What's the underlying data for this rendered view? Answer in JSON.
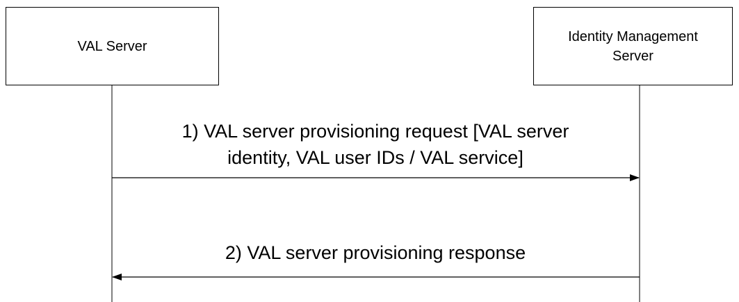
{
  "entities": {
    "val_server": {
      "label": "VAL Server"
    },
    "identity_management_server": {
      "label": "Identity Management\nServer"
    }
  },
  "messages": [
    {
      "label": "1) VAL server provisioning request [VAL server\nidentity, VAL user IDs / VAL service]",
      "from": "VAL Server",
      "to": "Identity Management Server"
    },
    {
      "label": "2) VAL server provisioning response",
      "from": "Identity Management Server",
      "to": "VAL Server"
    }
  ],
  "colors": {
    "line": "#000000",
    "background": "#ffffff"
  }
}
